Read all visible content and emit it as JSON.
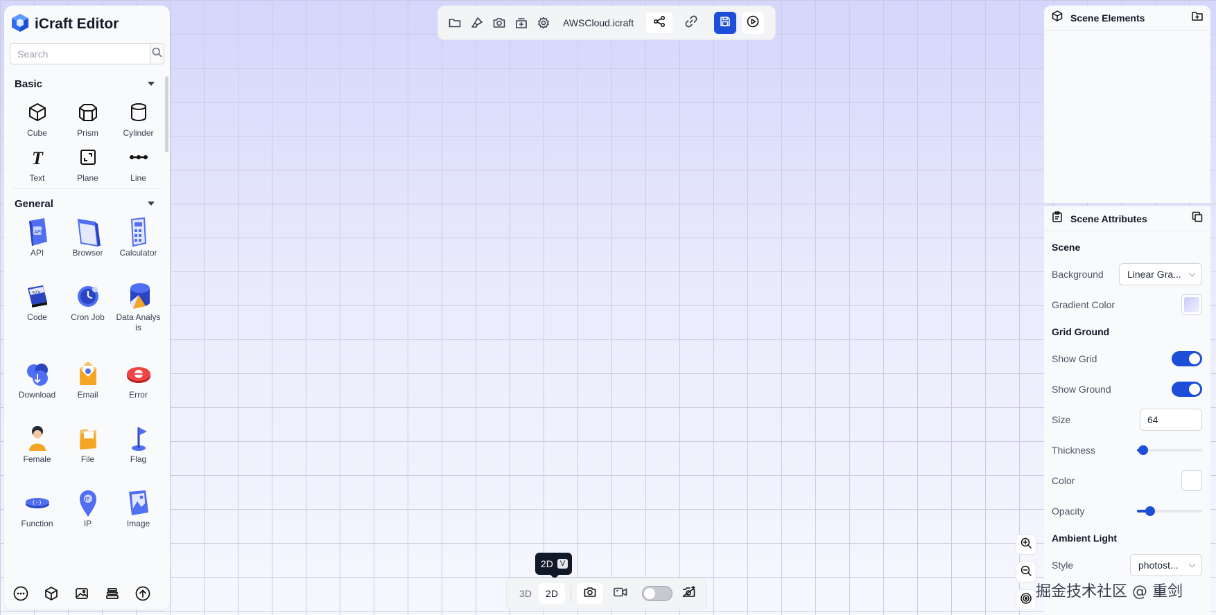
{
  "app": {
    "title": "iCraft Editor",
    "accent_color": "#1d4ed8",
    "brand_icon": "cube-logo-icon"
  },
  "sidebar": {
    "search_placeholder": "Search",
    "sections": [
      {
        "title": "Basic",
        "items": [
          {
            "label": "Cube",
            "icon": "cube-icon"
          },
          {
            "label": "Prism",
            "icon": "prism-icon"
          },
          {
            "label": "Cylinder",
            "icon": "cylinder-icon"
          },
          {
            "label": "Text",
            "icon": "text-icon"
          },
          {
            "label": "Plane",
            "icon": "plane-icon"
          },
          {
            "label": "Line",
            "icon": "line-icon"
          }
        ]
      },
      {
        "title": "General",
        "items": [
          {
            "label": "API",
            "icon": "api-icon"
          },
          {
            "label": "Browser",
            "icon": "browser-icon"
          },
          {
            "label": "Calculator",
            "icon": "calculator-icon"
          },
          {
            "label": "Code",
            "icon": "code-icon"
          },
          {
            "label": "Cron Job",
            "icon": "cron-job-icon"
          },
          {
            "label": "Data Analysis",
            "icon": "data-analysis-icon"
          },
          {
            "label": "Download",
            "icon": "download-icon"
          },
          {
            "label": "Email",
            "icon": "email-icon"
          },
          {
            "label": "Error",
            "icon": "error-icon"
          },
          {
            "label": "Female",
            "icon": "female-icon"
          },
          {
            "label": "File",
            "icon": "file-icon"
          },
          {
            "label": "Flag",
            "icon": "flag-icon"
          },
          {
            "label": "Function",
            "icon": "function-icon"
          },
          {
            "label": "IP",
            "icon": "ip-icon"
          },
          {
            "label": "Image",
            "icon": "image-icon"
          }
        ]
      }
    ],
    "bottom_icons": [
      "more-icon",
      "box-icon",
      "picture-icon",
      "layers-icon",
      "upload-icon"
    ]
  },
  "toolbar": {
    "file_name": "AWSCloud.icraft",
    "icons": [
      "folder-icon",
      "brush-icon",
      "camera-icon",
      "export-icon",
      "settings-icon",
      "share-nodes-icon",
      "link-icon",
      "save-icon",
      "play-icon"
    ]
  },
  "scene_elements": {
    "title": "Scene Elements"
  },
  "scene_attributes": {
    "title": "Scene Attributes",
    "scene": {
      "title": "Scene",
      "background_label": "Background",
      "background_value": "Linear Gra...",
      "gradient_color_label": "Gradient Color"
    },
    "grid_ground": {
      "title": "Grid Ground",
      "show_grid_label": "Show Grid",
      "show_grid": true,
      "show_ground_label": "Show Ground",
      "show_ground": true,
      "size_label": "Size",
      "size_value": "64",
      "thickness_label": "Thickness",
      "thickness": 0.1,
      "color_label": "Color",
      "opacity_label": "Opacity",
      "opacity": 0.2
    },
    "ambient_light": {
      "title": "Ambient Light",
      "style_label": "Style",
      "style_value": "photost..."
    }
  },
  "view_bar": {
    "mode_3d": "3D",
    "mode_2d": "2D",
    "active": "2D",
    "tooltip_text": "2D",
    "tooltip_key": "V"
  },
  "watermark": "掘金技术社区 @ 重剑"
}
